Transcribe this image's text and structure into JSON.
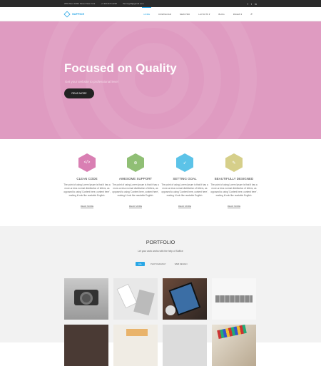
{
  "topbar": {
    "address": "295 West 120th Street New York",
    "phone": "+1 924 870 2220",
    "email": "themegrill@gmail.com",
    "social_icons": [
      "facebook-icon",
      "twitter-icon",
      "linkedin-icon"
    ]
  },
  "nav": {
    "brand": "SUFFICE",
    "items": [
      "HOME",
      "DOWNLOAD",
      "NEW PRO",
      "LAYOUTS",
      "BLOG",
      "PAGES"
    ],
    "active": "HOME"
  },
  "hero": {
    "title": "Focused on Quality",
    "subtitle": "Get your website to professional level",
    "button": "READ MORE",
    "background": "#df9bc1"
  },
  "features": [
    {
      "title": "CLEAN CODE",
      "icon": "code-icon",
      "color": "#d97fb3",
      "text": "The point of using Lorem Ipsum is that it has a more-or-less normal distribution of letters, as opposed to using 'Content here, content here', making it look like readable English.",
      "more": "READ MORE"
    },
    {
      "title": "AWESOME SUPPORT",
      "icon": "lifebuoy-icon",
      "color": "#90bf75",
      "text": "The point of using Lorem Ipsum is that it has a more-or-less normal distribution of letters, as opposed to using 'Content here, content here', making it look like readable English.",
      "more": "READ MORE"
    },
    {
      "title": "SETTING GOAL",
      "icon": "rocket-icon",
      "color": "#5cc3e8",
      "text": "The point of using Lorem Ipsum is that it has a more-or-less normal distribution of letters, as opposed to using 'Content here, content here', making it look like readable English.",
      "more": "READ MORE"
    },
    {
      "title": "BEAUTIFULLY DESIGNED",
      "icon": "brush-icon",
      "color": "#d6cf8a",
      "text": "The point of using Lorem Ipsum is that it has a more-or-less normal distribution of letters, as opposed to using 'Content here, content here', making it look like readable English.",
      "more": "READ MORE"
    }
  ],
  "portfolio": {
    "title": "PORTFOLIO",
    "subtitle": "Let your work works with the help of Suffice",
    "filters": [
      "ALL",
      "PHOTOGRAPHY",
      "WEB DESIGN"
    ],
    "active_filter": "ALL",
    "tiles": [
      "camera-photo",
      "phone-desk-photo",
      "tablet-coffee-photo",
      "letters-photo",
      "bottom-photo-1",
      "bottom-photo-2",
      "bottom-photo-3",
      "bottom-photo-4"
    ]
  }
}
